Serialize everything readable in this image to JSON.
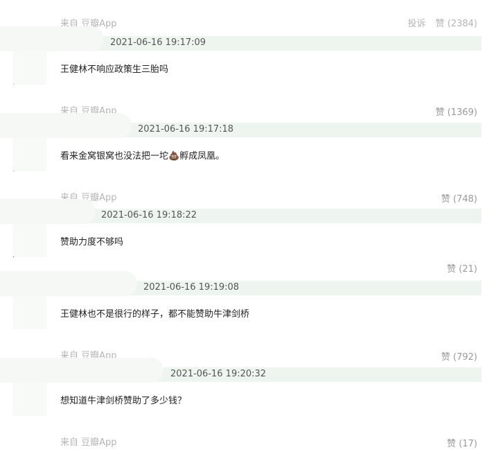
{
  "header": {
    "source": "来自 豆瓣App",
    "report_label": "投诉",
    "likes": "赞 (2384)"
  },
  "comments": [
    {
      "timestamp": "2021-06-16 19:17:09",
      "text": "王健林不响应政策生三胎吗",
      "source": "来自 豆瓣App",
      "likes": "赞 (1369)"
    },
    {
      "timestamp": "2021-06-16 19:17:18",
      "text": "看来金窝银窝也没法把一坨💩孵成凤凰。",
      "source": "来自 豆瓣App",
      "likes": "赞 (748)"
    },
    {
      "timestamp": "2021-06-16 19:18:22",
      "text": "赞助力度不够吗",
      "source": "",
      "likes": "赞 (21)"
    },
    {
      "timestamp": "2021-06-16 19:19:08",
      "text": "王健林也不是很行的样子，都不能赞助牛津剑桥",
      "source": "来自 豆瓣App",
      "likes": "赞 (792)"
    },
    {
      "timestamp": "2021-06-16 19:20:32",
      "text": "想知道牛津剑桥赞助了多少钱？",
      "source": "来自 豆瓣App",
      "likes": "赞 (17)"
    }
  ]
}
